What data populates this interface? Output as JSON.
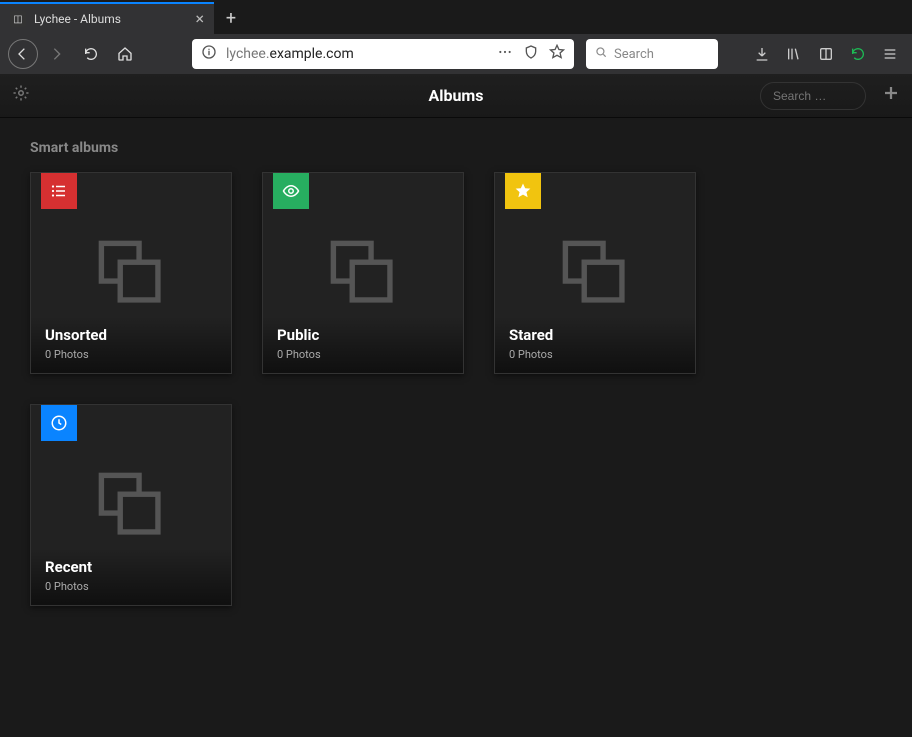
{
  "browser": {
    "tab_title": "Lychee - Albums",
    "url_prefix": "lychee.",
    "url_bold": "example.com",
    "search_placeholder": "Search"
  },
  "app": {
    "title": "Albums",
    "search_placeholder": "Search …"
  },
  "section_title": "Smart albums",
  "albums": [
    {
      "name": "Unsorted",
      "meta": "0 Photos",
      "badge_color": "red",
      "badge_icon": "list"
    },
    {
      "name": "Public",
      "meta": "0 Photos",
      "badge_color": "green",
      "badge_icon": "eye"
    },
    {
      "name": "Stared",
      "meta": "0 Photos",
      "badge_color": "yellow",
      "badge_icon": "star"
    },
    {
      "name": "Recent",
      "meta": "0 Photos",
      "badge_color": "blue",
      "badge_icon": "clock"
    }
  ]
}
